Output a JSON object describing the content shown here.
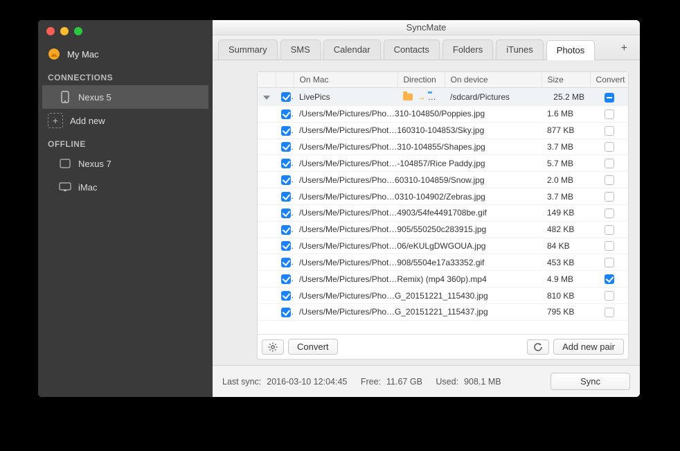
{
  "window": {
    "title": "SyncMate"
  },
  "sidebar": {
    "profile": "My Mac",
    "sections": {
      "connections": {
        "header": "CONNECTIONS",
        "items": [
          {
            "label": "Nexus 5",
            "icon": "phone"
          }
        ],
        "add_label": "Add new"
      },
      "offline": {
        "header": "OFFLINE",
        "items": [
          {
            "label": "Nexus 7",
            "icon": "tablet"
          },
          {
            "label": "iMac",
            "icon": "desktop"
          }
        ]
      }
    }
  },
  "tabs": [
    {
      "label": "Summary"
    },
    {
      "label": "SMS"
    },
    {
      "label": "Calendar"
    },
    {
      "label": "Contacts"
    },
    {
      "label": "Folders"
    },
    {
      "label": "iTunes"
    },
    {
      "label": "Photos",
      "active": true
    }
  ],
  "table": {
    "columns": {
      "on_mac": "On Mac",
      "direction": "Direction",
      "on_device": "On device",
      "size": "Size",
      "convert": "Convert"
    },
    "group": {
      "on_mac": "LivePics",
      "on_device": "/sdcard/Pictures",
      "size": "25.2 MB",
      "checked": true
    },
    "rows": [
      {
        "checked": true,
        "on_mac": "/Users/Me/Pictures/Pho…310-104850/Poppies.jpg",
        "size": "1.6 MB",
        "convert": false
      },
      {
        "checked": true,
        "on_mac": "/Users/Me/Pictures/Phot…160310-104853/Sky.jpg",
        "size": "877 KB",
        "convert": false
      },
      {
        "checked": true,
        "on_mac": "/Users/Me/Pictures/Phot…310-104855/Shapes.jpg",
        "size": "3.7 MB",
        "convert": false
      },
      {
        "checked": true,
        "on_mac": "/Users/Me/Pictures/Phot…-104857/Rice Paddy.jpg",
        "size": "5.7 MB",
        "convert": false
      },
      {
        "checked": true,
        "on_mac": "/Users/Me/Pictures/Pho…60310-104859/Snow.jpg",
        "size": "2.0 MB",
        "convert": false
      },
      {
        "checked": true,
        "on_mac": "/Users/Me/Pictures/Pho…0310-104902/Zebras.jpg",
        "size": "3.7 MB",
        "convert": false
      },
      {
        "checked": true,
        "on_mac": "/Users/Me/Pictures/Phot…4903/54fe4491708be.gif",
        "size": "149 KB",
        "convert": false
      },
      {
        "checked": true,
        "on_mac": "/Users/Me/Pictures/Phot…905/550250c283915.jpg",
        "size": "482 KB",
        "convert": false
      },
      {
        "checked": true,
        "on_mac": "/Users/Me/Pictures/Phot…06/eKULgDWGOUA.jpg",
        "size": "84 KB",
        "convert": false
      },
      {
        "checked": true,
        "on_mac": "/Users/Me/Pictures/Phot…908/5504e17a33352.gif",
        "size": "453 KB",
        "convert": false
      },
      {
        "checked": true,
        "on_mac": "/Users/Me/Pictures/Phot…Remix) (mp4 360p).mp4",
        "size": "4.9 MB",
        "convert": true
      },
      {
        "checked": true,
        "on_mac": "/Users/Me/Pictures/Pho…G_20151221_115430.jpg",
        "size": "810 KB",
        "convert": false
      },
      {
        "checked": true,
        "on_mac": "/Users/Me/Pictures/Pho…G_20151221_115437.jpg",
        "size": "795 KB",
        "convert": false
      }
    ]
  },
  "toolbar": {
    "convert": "Convert",
    "add_pair": "Add new pair"
  },
  "status": {
    "last_sync_label": "Last sync:",
    "last_sync_value": "2016-03-10 12:04:45",
    "free_label": "Free:",
    "free_value": "11.67 GB",
    "used_label": "Used:",
    "used_value": "908.1 MB",
    "sync_button": "Sync"
  }
}
